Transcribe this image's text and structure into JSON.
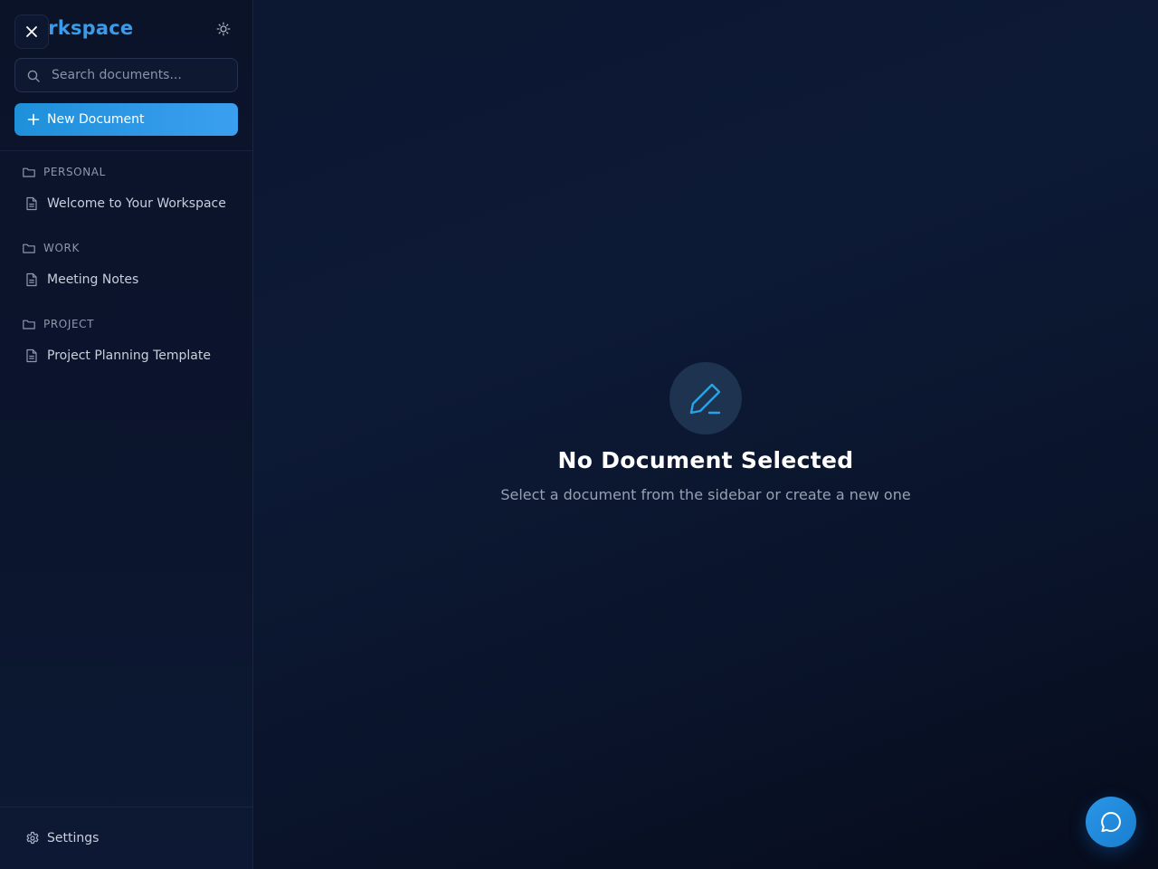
{
  "sidebar": {
    "brand": "Workspace",
    "search": {
      "placeholder": "Search documents...",
      "value": ""
    },
    "new_document_label": "New Document",
    "folders": [
      {
        "label": "PERSONAL",
        "documents": [
          {
            "title": "Welcome to Your Workspace"
          }
        ]
      },
      {
        "label": "WORK",
        "documents": [
          {
            "title": "Meeting Notes"
          }
        ]
      },
      {
        "label": "PROJECT",
        "documents": [
          {
            "title": "Project Planning Template"
          }
        ]
      }
    ],
    "settings_label": "Settings"
  },
  "main": {
    "empty_state": {
      "icon": "pen-icon",
      "title": "No Document Selected",
      "subtitle": "Select a document from the sidebar or create a new one"
    }
  },
  "icons": {
    "close": "close-icon",
    "theme": "sun-icon",
    "search": "search-icon",
    "new": "plus-icon",
    "folder": "folder-icon",
    "document": "file-text-icon",
    "settings": "gear-icon",
    "chat": "chat-icon"
  },
  "colors": {
    "accent": "#3a9be8",
    "button_gradient_start": "#1e90da",
    "button_gradient_end": "#3b9ff0",
    "background": "#0c1630"
  }
}
